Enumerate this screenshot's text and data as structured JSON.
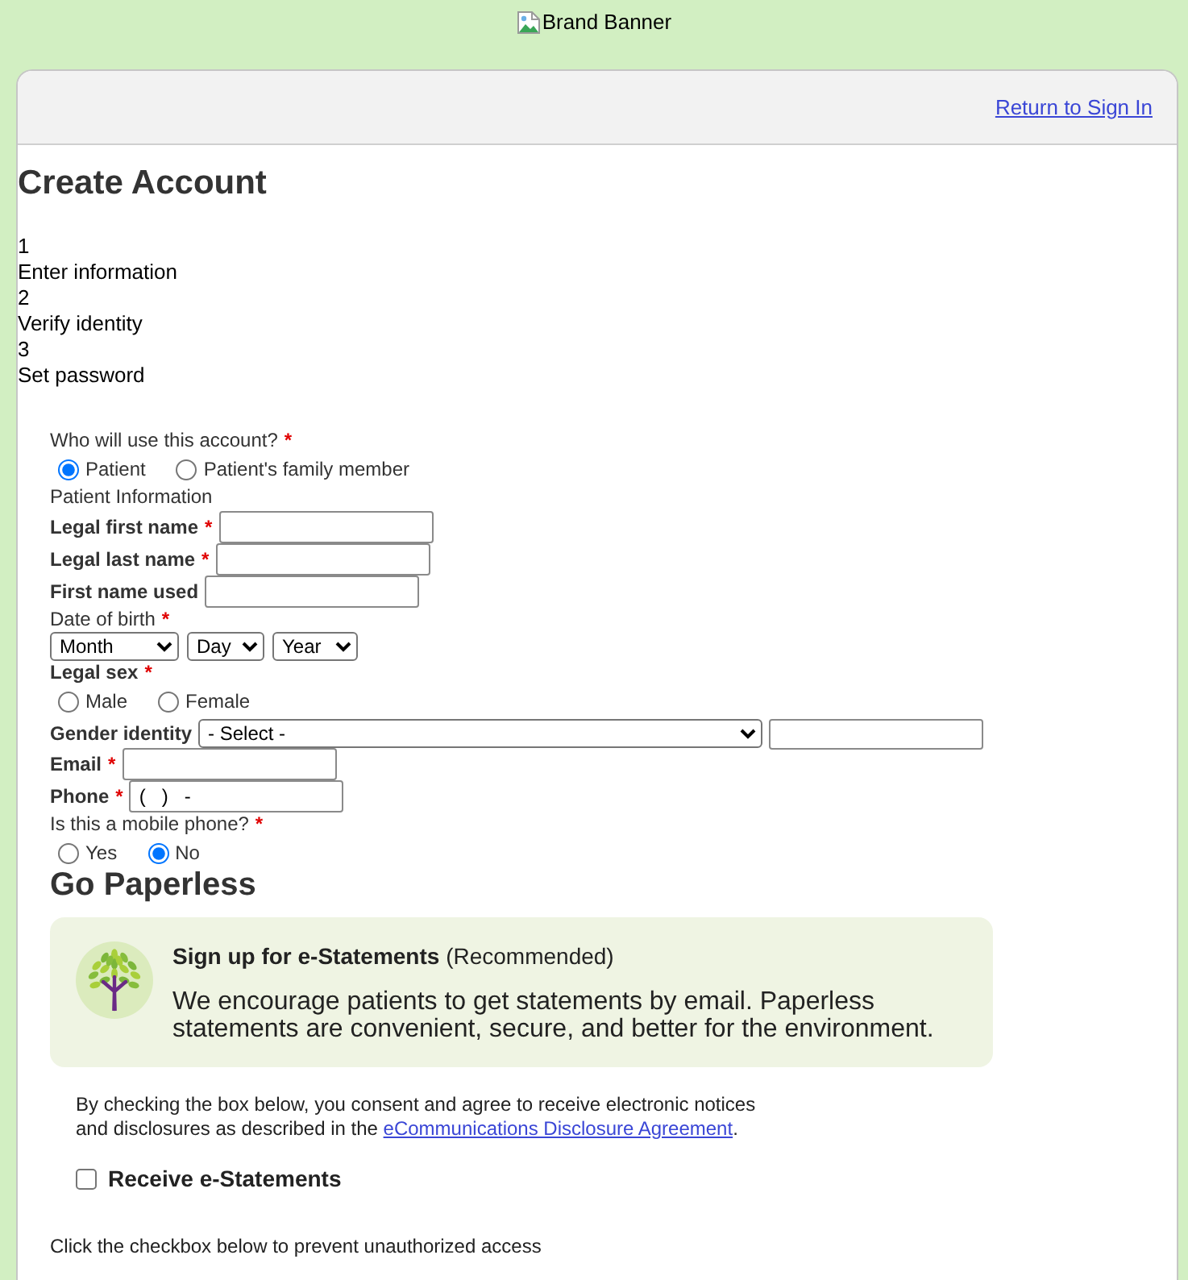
{
  "banner": {
    "text": "Brand Banner"
  },
  "header": {
    "link": "Return to Sign In"
  },
  "title": "Create Account",
  "steps": [
    {
      "number": "1",
      "label": "Enter information"
    },
    {
      "number": "2",
      "label": "Verify identity"
    },
    {
      "number": "3",
      "label": "Set password"
    }
  ],
  "form": [
    {
      "kind": "question",
      "label": "Who will use this account?",
      "required_mark": "*",
      "options": [
        {
          "label": "Patient",
          "selected": true
        },
        {
          "label": "Patient's family member",
          "selected": false
        }
      ]
    },
    {
      "kind": "section",
      "label": "Patient Information"
    },
    {
      "kind": "text",
      "label": "Legal first name",
      "required_mark": "*"
    },
    {
      "kind": "text",
      "label": "Legal last name",
      "required_mark": "*"
    },
    {
      "kind": "text",
      "label": "First name used"
    },
    {
      "kind": "date",
      "label": "Date of birth",
      "required_mark": "*",
      "selects": [
        "Month",
        "Day",
        "Year"
      ]
    },
    {
      "kind": "choice",
      "label": "Legal sex",
      "required_mark": "*",
      "options": [
        {
          "label": "Male",
          "selected": false
        },
        {
          "label": "Female",
          "selected": false
        }
      ]
    },
    {
      "kind": "select_text",
      "label": "Gender identity",
      "select": "- Select -"
    },
    {
      "kind": "text",
      "label": "Email",
      "required_mark": "*"
    },
    {
      "kind": "text",
      "label": "Phone",
      "required_mark": "*",
      "value": "(   )   -"
    },
    {
      "kind": "question",
      "label": "Is this a mobile phone?",
      "required_mark": "*",
      "options": [
        {
          "label": "Yes",
          "selected": false
        },
        {
          "label": "No",
          "selected": true
        }
      ]
    }
  ],
  "paperless": {
    "heading": "Go Paperless",
    "promo": {
      "title": "**Sign up for e-Statements** (Recommended)",
      "body": "We encourage patients to get statements by email. Paperless statements are convenient, secure, and better for the environment."
    },
    "consent": {
      "text": "By checking the box below, you consent and agree to receive electronic notices and disclosures as described in the",
      "link": "eCommunications Disclosure Agreement",
      "end": "."
    },
    "checkbox": {
      "label": "Receive e-Statements",
      "checked": false
    }
  },
  "footer_note": "Click the checkbox below to prevent unauthorized access"
}
